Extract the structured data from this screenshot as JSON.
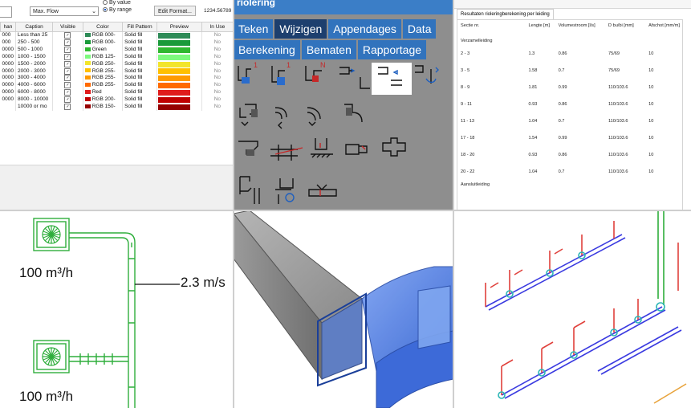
{
  "legend_panel": {
    "combo_value": "Max. Flow",
    "radio_top": "By value",
    "radio_range": "By range",
    "edit_button": "Edit Format...",
    "number_field": "1234.56789",
    "headers": [
      "han",
      "Caption",
      "Visible",
      "Color",
      "Fill Pattern",
      "Preview",
      "In Use"
    ],
    "rows": [
      {
        "from": "000",
        "caption": "Less than 25",
        "color_name": "RGB 000-",
        "color": "#2e8b57",
        "fill": "Solid fill",
        "in_use": "No"
      },
      {
        "from": "000",
        "caption": "250 - 500",
        "color_name": "RGB 000-",
        "color": "#1a9a3a",
        "fill": "Solid fill",
        "in_use": "No"
      },
      {
        "from": "0000",
        "caption": "500 - 1000",
        "color_name": "Green",
        "color": "#2fb82f",
        "fill": "Solid fill",
        "in_use": "No"
      },
      {
        "from": "0000",
        "caption": "1000 - 1500",
        "color_name": "RGB 125-",
        "color": "#7dfa7d",
        "fill": "Solid fill",
        "in_use": "No"
      },
      {
        "from": "0000",
        "caption": "1500 - 2000",
        "color_name": "RGB 250-",
        "color": "#f2e52b",
        "fill": "Solid fill",
        "in_use": "No"
      },
      {
        "from": "0000",
        "caption": "2000 - 3000",
        "color_name": "RGB 255-",
        "color": "#ffc000",
        "fill": "Solid fill",
        "in_use": "No"
      },
      {
        "from": "0000",
        "caption": "3000 - 4000",
        "color_name": "RGB 255-",
        "color": "#ff9a00",
        "fill": "Solid fill",
        "in_use": "No"
      },
      {
        "from": "0000",
        "caption": "4000 - 6000",
        "color_name": "RGB 255-",
        "color": "#ff6a00",
        "fill": "Solid fill",
        "in_use": "No"
      },
      {
        "from": "0000",
        "caption": "6000 - 8000",
        "color_name": "Red",
        "color": "#e01b1b",
        "fill": "Solid fill",
        "in_use": "No"
      },
      {
        "from": "0000",
        "caption": "8000 - 10000",
        "color_name": "RGB 200-",
        "color": "#c00000",
        "fill": "Solid fill",
        "in_use": "No"
      },
      {
        "from": "",
        "caption": "10000 or mo",
        "color_name": "RGB 150-",
        "color": "#960000",
        "fill": "Solid fill",
        "in_use": "No"
      }
    ]
  },
  "ribbon": {
    "title": "riolering",
    "tabs_row1": [
      "Teken",
      "Wijzigen",
      "Appendages",
      "Data"
    ],
    "tabs_row2": [
      "Berekening",
      "Bematen",
      "Rapportage"
    ],
    "icon_labels": [
      "1",
      "1",
      "N"
    ]
  },
  "results": {
    "tab": "Resultaten rioleringberekening per leiding",
    "headers": [
      "Sectie nr.",
      "Lengte [m]",
      "Volumestroom [l/s]",
      "D bu/bi [mm]",
      "Afschot [mm/m]"
    ],
    "group1": "Verzamelleiding",
    "group2": "Aansluitleiding",
    "rows": [
      [
        "2 - 3",
        "1.3",
        "0.86",
        "75/69",
        "10"
      ],
      [
        "3 - 5",
        "1.58",
        "0.7",
        "75/69",
        "10"
      ],
      [
        "8 - 9",
        "1.81",
        "0.99",
        "110/103.6",
        "10"
      ],
      [
        "9 - 11",
        "0.93",
        "0.86",
        "110/103.6",
        "10"
      ],
      [
        "11 - 13",
        "1.04",
        "0.7",
        "110/103.6",
        "10"
      ],
      [
        "17 - 18",
        "1.54",
        "0.99",
        "110/103.6",
        "10"
      ],
      [
        "18 - 20",
        "0.93",
        "0.86",
        "110/103.6",
        "10"
      ],
      [
        "20 - 22",
        "1.04",
        "0.7",
        "110/103.6",
        "10"
      ]
    ]
  },
  "duct_drawing": {
    "flow1": "100 m³/h",
    "flow2": "100 m³/h",
    "velocity": "2.3 m/s"
  },
  "colors": {
    "ribbon_blue": "#3173bd",
    "ribbon_dark": "#1d3f6e",
    "duct_green": "#2fae3c",
    "pipe_red": "#e0413c",
    "pipe_blue": "#3a3ae0",
    "fitting_cyan": "#2bb5b5"
  }
}
